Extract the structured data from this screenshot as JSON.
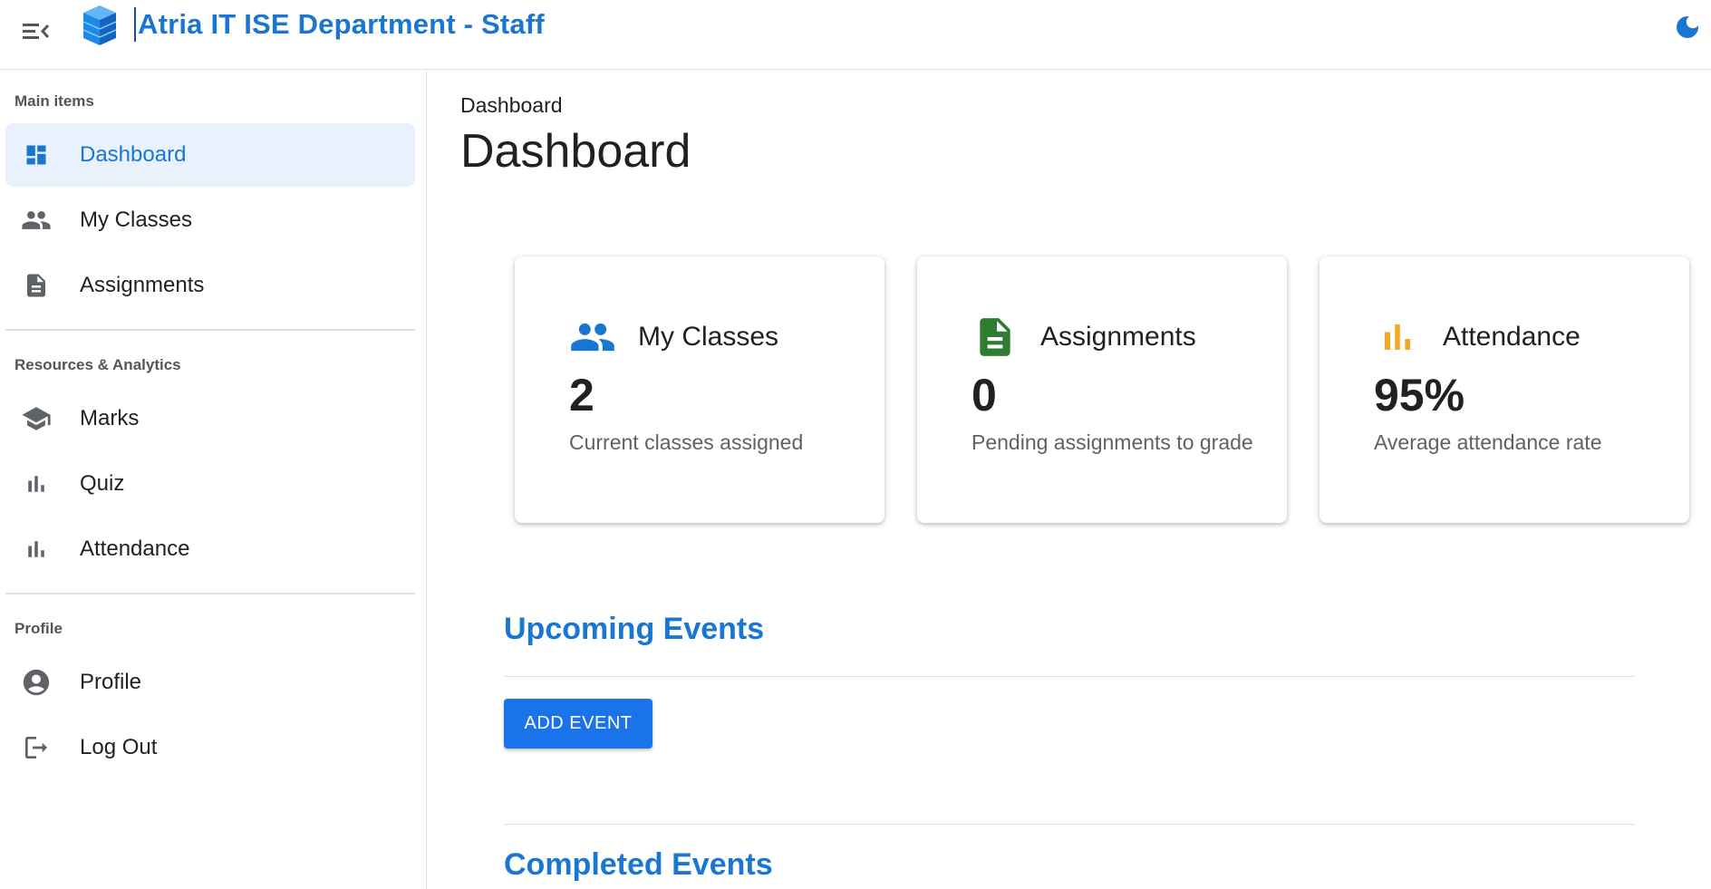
{
  "app": {
    "title": "Atria IT ISE Department - Staff"
  },
  "sidebar": {
    "sections": [
      {
        "header": "Main items",
        "items": [
          {
            "label": "Dashboard",
            "icon": "dashboard-icon",
            "active": true
          },
          {
            "label": "My Classes",
            "icon": "people-icon"
          },
          {
            "label": "Assignments",
            "icon": "document-icon"
          }
        ]
      },
      {
        "header": "Resources & Analytics",
        "items": [
          {
            "label": "Marks",
            "icon": "school-icon"
          },
          {
            "label": "Quiz",
            "icon": "bar-chart-icon"
          },
          {
            "label": "Attendance",
            "icon": "bar-chart-icon"
          }
        ]
      },
      {
        "header": "Profile",
        "items": [
          {
            "label": "Profile",
            "icon": "account-circle-icon"
          },
          {
            "label": "Log Out",
            "icon": "logout-icon"
          }
        ]
      }
    ]
  },
  "main": {
    "breadcrumb": "Dashboard",
    "title": "Dashboard",
    "cards": [
      {
        "title": "My Classes",
        "value": "2",
        "subtitle": "Current classes assigned",
        "icon": "people-icon",
        "icon_color": "#1976d2"
      },
      {
        "title": "Assignments",
        "value": "0",
        "subtitle": "Pending assignments to grade",
        "icon": "document-icon",
        "icon_color": "#2e7d32"
      },
      {
        "title": "Attendance",
        "value": "95%",
        "subtitle": "Average attendance rate",
        "icon": "bar-chart-icon",
        "icon_color": "#f5a623"
      }
    ],
    "upcoming_events": {
      "heading": "Upcoming Events",
      "add_button": "ADD EVENT"
    },
    "completed_events": {
      "heading": "Completed Events"
    }
  },
  "colors": {
    "accent": "#1976d2",
    "active_bg": "#e9f2fc",
    "button": "#1a73e8"
  }
}
